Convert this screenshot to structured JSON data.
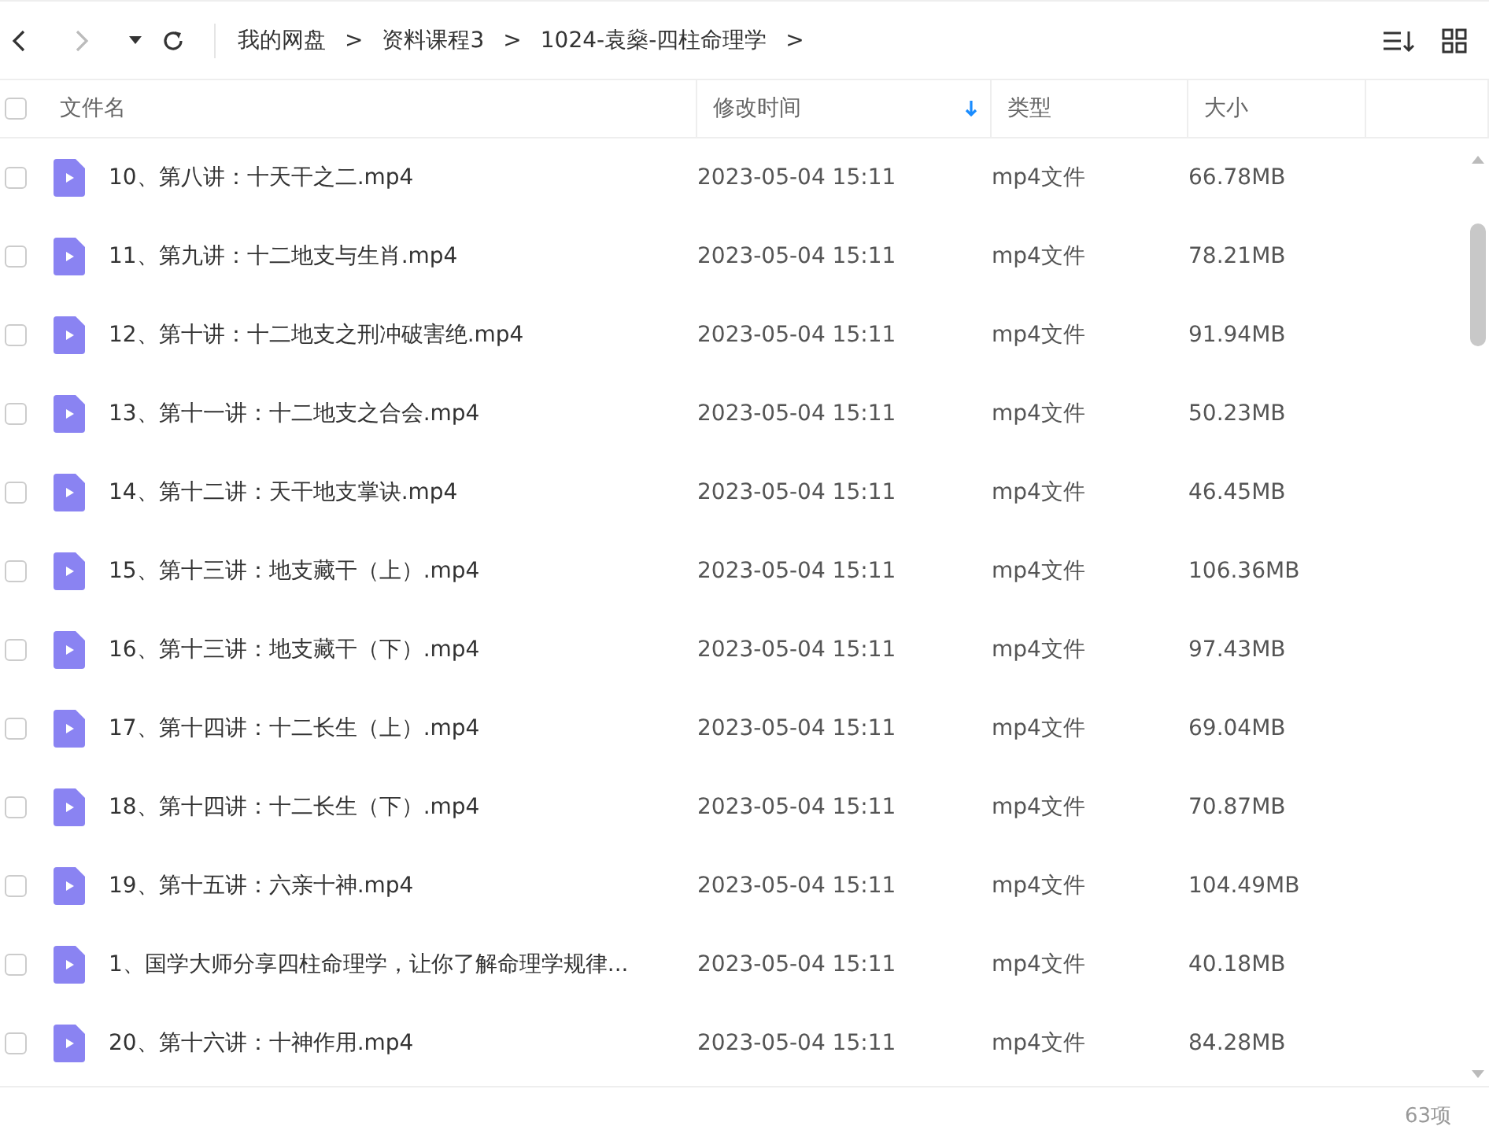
{
  "breadcrumb": [
    "我的网盘",
    "资料课程3",
    "1024-袁燊-四柱命理学"
  ],
  "separator": ">",
  "columns": [
    {
      "label": "文件名",
      "sorted": false
    },
    {
      "label": "修改时间",
      "sorted": true
    },
    {
      "label": "类型",
      "sorted": false
    },
    {
      "label": "大小",
      "sorted": false
    }
  ],
  "select_all": {
    "checked": false
  },
  "rows": [
    {
      "name": "10、第八讲：十天干之二.mp4",
      "modified": "2023-05-04 15:11",
      "type": "mp4文件",
      "size": "66.78MB",
      "checked": false
    },
    {
      "name": "11、第九讲：十二地支与生肖.mp4",
      "modified": "2023-05-04 15:11",
      "type": "mp4文件",
      "size": "78.21MB",
      "checked": false
    },
    {
      "name": "12、第十讲：十二地支之刑冲破害绝.mp4",
      "modified": "2023-05-04 15:11",
      "type": "mp4文件",
      "size": "91.94MB",
      "checked": false
    },
    {
      "name": "13、第十一讲：十二地支之合会.mp4",
      "modified": "2023-05-04 15:11",
      "type": "mp4文件",
      "size": "50.23MB",
      "checked": false
    },
    {
      "name": "14、第十二讲：天干地支掌诀.mp4",
      "modified": "2023-05-04 15:11",
      "type": "mp4文件",
      "size": "46.45MB",
      "checked": false
    },
    {
      "name": "15、第十三讲：地支藏干（上）.mp4",
      "modified": "2023-05-04 15:11",
      "type": "mp4文件",
      "size": "106.36MB",
      "checked": false
    },
    {
      "name": "16、第十三讲：地支藏干（下）.mp4",
      "modified": "2023-05-04 15:11",
      "type": "mp4文件",
      "size": "97.43MB",
      "checked": false
    },
    {
      "name": "17、第十四讲：十二长生（上）.mp4",
      "modified": "2023-05-04 15:11",
      "type": "mp4文件",
      "size": "69.04MB",
      "checked": false
    },
    {
      "name": "18、第十四讲：十二长生（下）.mp4",
      "modified": "2023-05-04 15:11",
      "type": "mp4文件",
      "size": "70.87MB",
      "checked": false
    },
    {
      "name": "19、第十五讲：六亲十神.mp4",
      "modified": "2023-05-04 15:11",
      "type": "mp4文件",
      "size": "104.49MB",
      "checked": false
    },
    {
      "name": "1、国学大师分享四柱命理学，让你了解命理学规律...",
      "modified": "2023-05-04 15:11",
      "type": "mp4文件",
      "size": "40.18MB",
      "checked": false
    },
    {
      "name": "20、第十六讲：十神作用.mp4",
      "modified": "2023-05-04 15:11",
      "type": "mp4文件",
      "size": "84.28MB",
      "checked": false
    }
  ],
  "item_count": "63项"
}
